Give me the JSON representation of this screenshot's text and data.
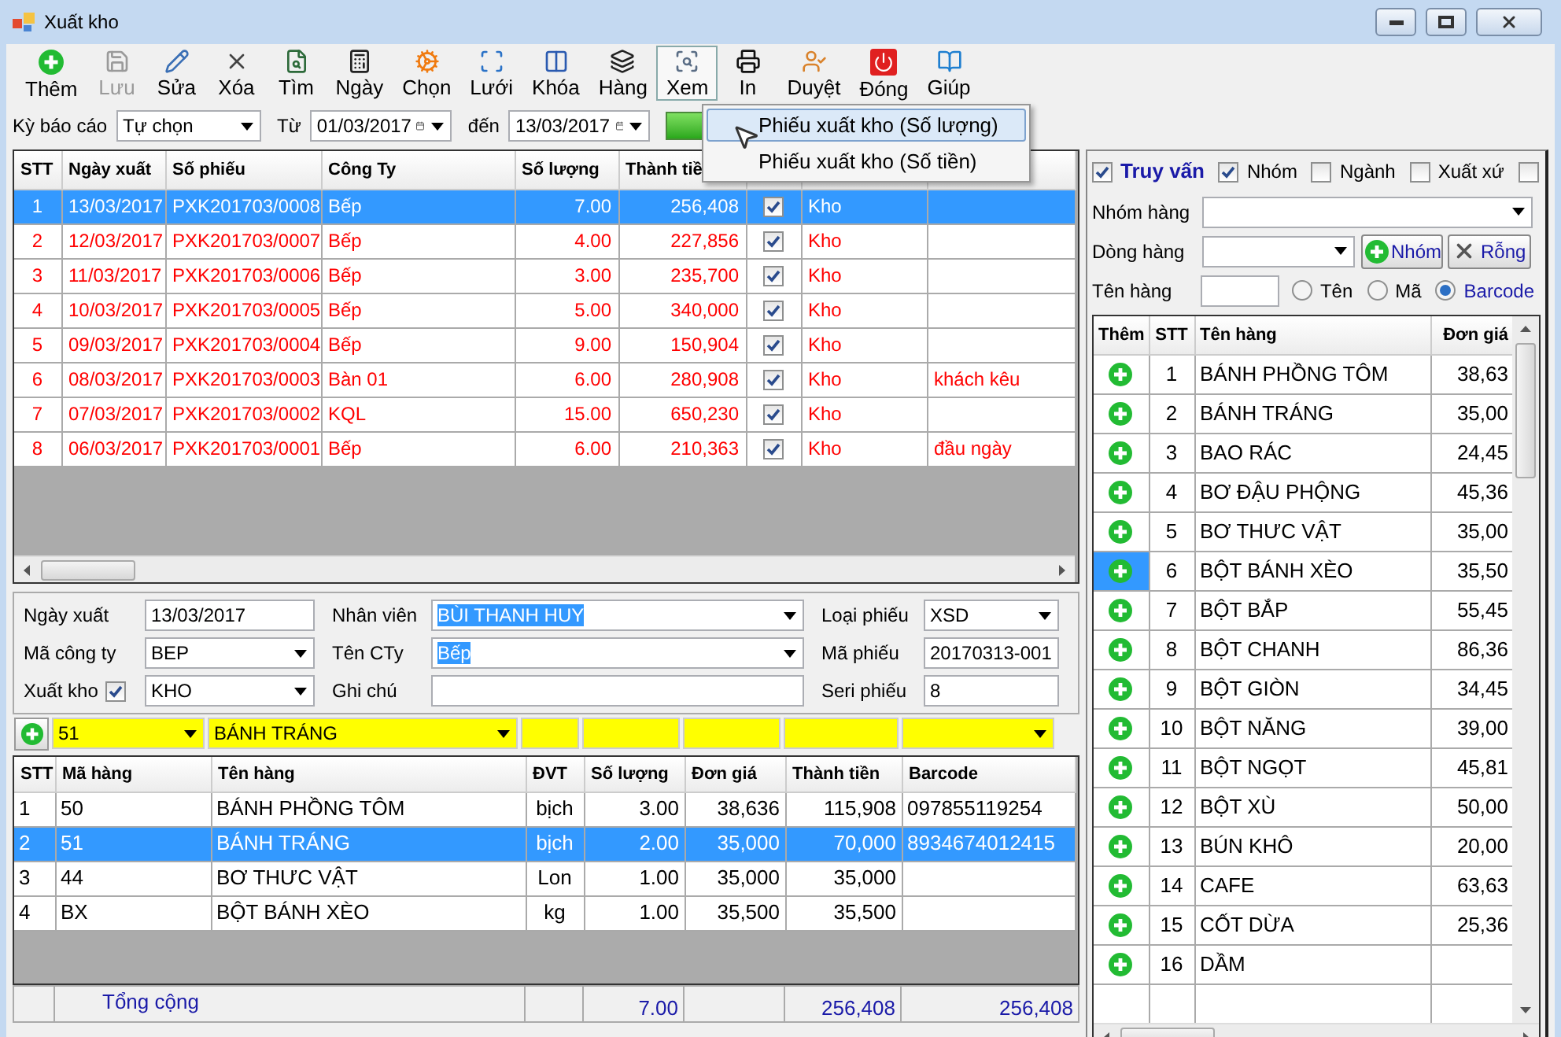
{
  "window": {
    "title": "Xuất kho"
  },
  "toolbar": [
    {
      "label": "Thêm",
      "disabled": false,
      "selected": false
    },
    {
      "label": "Lưu",
      "disabled": true,
      "selected": false
    },
    {
      "label": "Sửa",
      "disabled": false,
      "selected": false
    },
    {
      "label": "Xóa",
      "disabled": false,
      "selected": false
    },
    {
      "label": "Tìm",
      "disabled": false,
      "selected": false
    },
    {
      "label": "Ngày",
      "disabled": false,
      "selected": false
    },
    {
      "label": "Chọn",
      "disabled": false,
      "selected": false
    },
    {
      "label": "Lưới",
      "disabled": false,
      "selected": false
    },
    {
      "label": "Khóa",
      "disabled": false,
      "selected": false
    },
    {
      "label": "Hàng",
      "disabled": false,
      "selected": false
    },
    {
      "label": "Xem",
      "disabled": false,
      "selected": true
    },
    {
      "label": "In",
      "disabled": false,
      "selected": false
    },
    {
      "label": "Duyệt",
      "disabled": false,
      "selected": false
    },
    {
      "label": "Đóng",
      "disabled": false,
      "selected": false
    },
    {
      "label": "Giúp",
      "disabled": false,
      "selected": false
    }
  ],
  "menu": [
    {
      "label": "Phiếu xuất kho (Số lượng)",
      "selected": true
    },
    {
      "label": "Phiếu xuất kho (Số tiền)",
      "selected": false
    }
  ],
  "filter": {
    "period_label": "Kỳ báo cáo",
    "period": "Tự chọn",
    "from_label": "Từ",
    "from": "01/03/2017",
    "to_label": "đến",
    "to": "13/03/2017"
  },
  "vouchers": {
    "columns": [
      "STT",
      "Ngày xuất",
      "Số phiếu",
      "Công Ty",
      "Số lượng",
      "Thành tiề"
    ],
    "rows": [
      {
        "cells": [
          "1",
          "13/03/2017",
          "PXK201703/0008",
          "Bếp",
          "7.00",
          "256,408",
          "Kho"
        ],
        "checked": true,
        "selected": true
      },
      {
        "cells": [
          "2",
          "12/03/2017",
          "PXK201703/0007",
          "Bếp",
          "4.00",
          "227,856",
          "Kho"
        ],
        "checked": true,
        "selected": false
      },
      {
        "cells": [
          "3",
          "11/03/2017",
          "PXK201703/0006",
          "Bếp",
          "3.00",
          "235,700",
          "Kho"
        ],
        "checked": true,
        "selected": false
      },
      {
        "cells": [
          "4",
          "10/03/2017",
          "PXK201703/0005",
          "Bếp",
          "5.00",
          "340,000",
          "Kho"
        ],
        "checked": true,
        "selected": false
      },
      {
        "cells": [
          "5",
          "09/03/2017",
          "PXK201703/0004",
          "Bếp",
          "9.00",
          "150,904",
          "Kho"
        ],
        "checked": true,
        "selected": false
      },
      {
        "cells": [
          "6",
          "08/03/2017",
          "PXK201703/0003",
          "Bàn 01",
          "6.00",
          "280,908",
          "Kho",
          "khách kêu"
        ],
        "checked": true,
        "selected": false
      },
      {
        "cells": [
          "7",
          "07/03/2017",
          "PXK201703/0002",
          "KQL",
          "15.00",
          "650,230",
          "Kho"
        ],
        "checked": true,
        "selected": false
      },
      {
        "cells": [
          "8",
          "06/03/2017",
          "PXK201703/0001",
          "Bếp",
          "6.00",
          "210,363",
          "Kho",
          "đầu ngày"
        ],
        "checked": true,
        "selected": false
      }
    ]
  },
  "form": [
    [
      {
        "label": "Ngày xuất",
        "kind": "input",
        "value": "13/03/2017",
        "highlighted": false
      },
      {
        "label": "Nhân viên",
        "kind": "select",
        "value": "BÙI THANH HUY",
        "highlighted": true
      },
      {
        "label": "Loại phiếu",
        "kind": "select",
        "value": "XSD",
        "highlighted": false
      }
    ],
    [
      {
        "label": "Mã công ty",
        "kind": "select",
        "value": "BEP",
        "highlighted": false
      },
      {
        "label": "Tên CTy",
        "kind": "select",
        "value": "Bếp",
        "highlighted": true
      },
      {
        "label": "Mã phiếu",
        "kind": "input",
        "value": "20170313-001",
        "highlighted": false
      }
    ],
    [
      {
        "label": "Xuất kho",
        "kind": "checkselect",
        "checked": true,
        "value": "KHO",
        "highlighted": false
      },
      {
        "label": "Ghi chú",
        "kind": "input"
      },
      {
        "label": "Seri phiếu",
        "kind": "input",
        "value": "8",
        "highlighted": false
      }
    ]
  ],
  "entry_row": [
    {
      "kind": "select",
      "value": "51"
    },
    {
      "kind": "select",
      "value": "BÁNH TRÁNG"
    },
    {
      "kind": "input"
    },
    {
      "kind": "input"
    },
    {
      "kind": "input"
    },
    {
      "kind": "input"
    },
    {
      "kind": "select"
    }
  ],
  "items": {
    "columns": [
      "STT",
      "Mã hàng",
      "Tên hàng",
      "ĐVT",
      "Số lượng",
      "Đơn giá",
      "Thành tiền",
      "Barcode"
    ],
    "rows": [
      {
        "cells": [
          "1",
          "50",
          "BÁNH PHỒNG TÔM",
          "bịch",
          "3.00",
          "38,636",
          "115,908",
          "097855119254"
        ],
        "selected": false
      },
      {
        "cells": [
          "2",
          "51",
          "BÁNH TRÁNG",
          "bịch",
          "2.00",
          "35,000",
          "70,000",
          "8934674012415"
        ],
        "selected": true
      },
      {
        "cells": [
          "3",
          "44",
          "BƠ THƯC VẬT",
          "Lon",
          "1.00",
          "35,000",
          "35,000"
        ],
        "selected": false
      },
      {
        "cells": [
          "4",
          "BX",
          "BỘT BÁNH XÈO",
          "kg",
          "1.00",
          "35,500",
          "35,500"
        ],
        "selected": false
      }
    ],
    "total": {
      "label": "Tổng cộng",
      "quantity": "7.00",
      "amount": "256,408",
      "grand": "256,408"
    }
  },
  "search_panel": {
    "checkboxes": [
      {
        "label": "Truy vấn",
        "checked": true,
        "kind": "title"
      },
      {
        "label": "Nhóm",
        "checked": true,
        "kind": "plain"
      },
      {
        "label": "Ngành",
        "checked": false,
        "kind": "plain"
      },
      {
        "label": "Xuất xứ",
        "checked": false,
        "kind": "plain"
      },
      {
        "checked": false,
        "kind": "plain"
      }
    ],
    "group_label": "Nhóm hàng",
    "line_label": "Dòng hàng",
    "buttons": [
      "Nhóm",
      "Rỗng"
    ],
    "name_label": "Tên hàng",
    "search_by": [
      {
        "label": "Tên",
        "selected": false
      },
      {
        "label": "Mã",
        "selected": false
      },
      {
        "label": "Barcode",
        "selected": true
      }
    ],
    "columns": [
      "Thêm",
      "STT",
      "Tên hàng",
      "Đơn giá"
    ],
    "rows": [
      {
        "stt": "1",
        "name": "BÁNH PHỒNG TÔM",
        "price": "38,63",
        "selected": false
      },
      {
        "stt": "2",
        "name": "BÁNH TRÁNG",
        "price": "35,00",
        "selected": false
      },
      {
        "stt": "3",
        "name": "BAO RÁC",
        "price": "24,45",
        "selected": false
      },
      {
        "stt": "4",
        "name": "BƠ ĐẬU PHỘNG",
        "price": "45,36",
        "selected": false
      },
      {
        "stt": "5",
        "name": "BƠ THƯC VẬT",
        "price": "35,00",
        "selected": false
      },
      {
        "stt": "6",
        "name": "BỘT BÁNH XÈO",
        "price": "35,50",
        "selected": true
      },
      {
        "stt": "7",
        "name": "BỘT BẮP",
        "price": "55,45",
        "selected": false
      },
      {
        "stt": "8",
        "name": "BỘT CHANH",
        "price": "86,36",
        "selected": false
      },
      {
        "stt": "9",
        "name": "BỘT GIÒN",
        "price": "34,45",
        "selected": false
      },
      {
        "stt": "10",
        "name": "BỘT NĂNG",
        "price": "39,00",
        "selected": false
      },
      {
        "stt": "11",
        "name": "BỘT NGỌT",
        "price": "45,81",
        "selected": false
      },
      {
        "stt": "12",
        "name": "BỘT XÙ",
        "price": "50,00",
        "selected": false
      },
      {
        "stt": "13",
        "name": "BÚN KHÔ",
        "price": "20,00",
        "selected": false
      },
      {
        "stt": "14",
        "name": "CAFE",
        "price": "63,63",
        "selected": false
      },
      {
        "stt": "15",
        "name": "CỐT DỪA",
        "price": "25,36",
        "selected": false
      },
      {
        "stt": "16",
        "name": "DẦM",
        "selected": false
      }
    ]
  }
}
